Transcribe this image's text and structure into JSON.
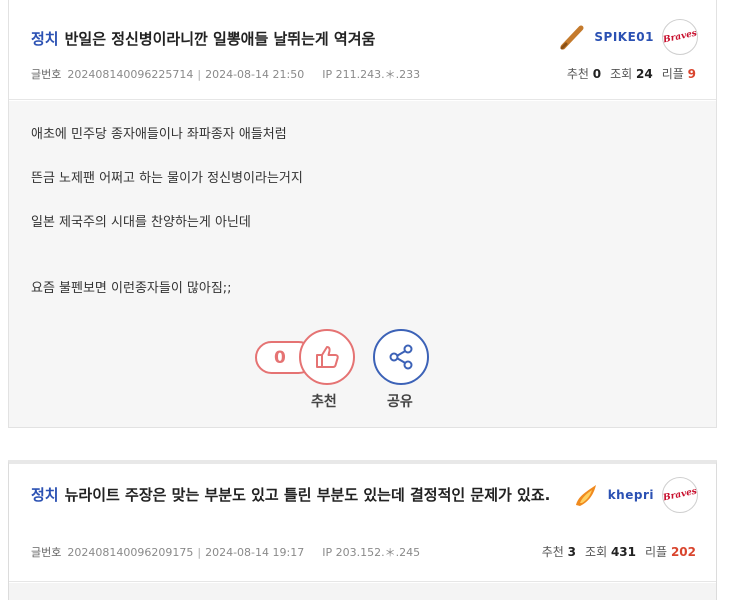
{
  "posts": [
    {
      "category": "정치",
      "title": "반일은 정신병이라니깐 일뽕애들 날뛰는게 역겨움",
      "number_label": "글번호",
      "number": "202408140096225714",
      "date": "2024-08-14 21:50",
      "ip_label": "IP",
      "ip": "211.243.＊.233",
      "nickname": "SPIKE01",
      "level_icon": "baseball-bat-icon",
      "avatar_text": "Braves",
      "stats": {
        "rec_label": "추천",
        "rec": "0",
        "view_label": "조회",
        "view": "24",
        "reply_label": "리플",
        "reply": "9"
      },
      "body_lines": [
        "애초에 민주당 종자애들이나 좌파종자 애들처럼",
        "뜬금 노제팬 어쩌고 하는 물이가 정신병이라는거지",
        "일본 제국주의 시대를 찬양하는게 아닌데",
        "요즘 불펜보면 이런종자들이 많아짐;;"
      ],
      "recommend_count": "0",
      "recommend_label": "추천",
      "share_label": "공유"
    },
    {
      "category": "정치",
      "title": "뉴라이트 주장은 맞는 부분도 있고 틀린 부분도 있는데 결정적인 문제가 있죠.",
      "number_label": "글번호",
      "number": "202408140096209175",
      "date": "2024-08-14 19:17",
      "ip_label": "IP",
      "ip": "203.152.＊.245",
      "nickname": "khepri",
      "level_icon": "flame-icon",
      "avatar_text": "Braves",
      "stats": {
        "rec_label": "추천",
        "rec": "3",
        "view_label": "조회",
        "view": "431",
        "reply_label": "리플",
        "reply": "202"
      }
    }
  ],
  "colors": {
    "accent_blue": "#2b51b3",
    "recommend_red": "#e57373",
    "share_blue": "#3c62b7",
    "reply_red": "#d9452e"
  }
}
